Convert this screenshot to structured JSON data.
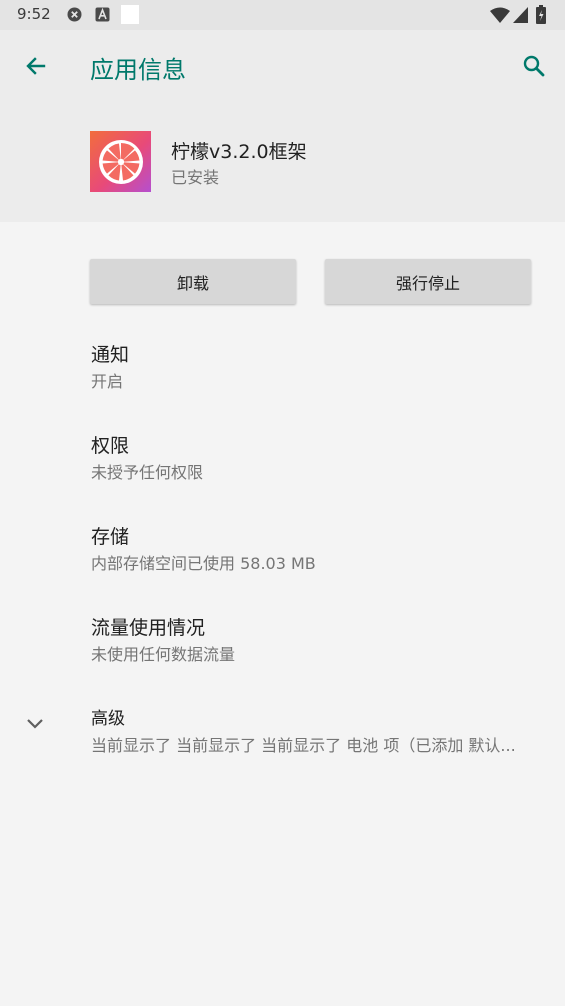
{
  "status_bar": {
    "time": "9:52",
    "notification_icons": [
      "close-circle-icon",
      "a-badge-icon",
      "blank-square-icon"
    ],
    "system_icons": [
      "wifi-icon",
      "signal-icon",
      "battery-icon"
    ]
  },
  "app_bar": {
    "title": "应用信息",
    "back_icon": "arrow-left-icon",
    "search_icon": "search-icon",
    "accent_color": "#00796b"
  },
  "app": {
    "name": "柠檬v3.2.0框架",
    "status": "已安装",
    "icon": "lemon-slice-icon"
  },
  "buttons": {
    "uninstall": "卸载",
    "force_stop": "强行停止"
  },
  "settings": [
    {
      "title": "通知",
      "summary": "开启"
    },
    {
      "title": "权限",
      "summary": "未授予任何权限"
    },
    {
      "title": "存储",
      "summary": "内部存储空间已使用 58.03 MB"
    },
    {
      "title": "流量使用情况",
      "summary": "未使用任何数据流量"
    }
  ],
  "advanced": {
    "title": "高级",
    "summary": "当前显示了 当前显示了 当前显示了 电池 项（已添加 默认...",
    "expand_icon": "chevron-down-icon"
  }
}
